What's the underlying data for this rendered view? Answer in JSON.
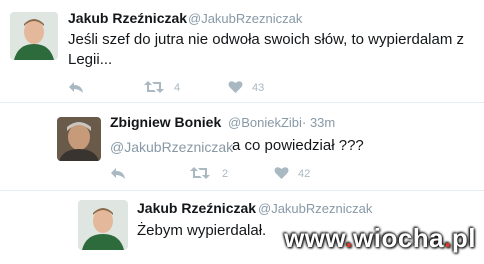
{
  "tweet1": {
    "name": "Jakub Rzeźniczak",
    "handle": "@JakubRzezniczak",
    "text_line1": "Jeśli szef do jutra nie odwoła swoich słów, to wypierdalam z",
    "text_line2": "Legii...",
    "retweets": "4",
    "likes": "43"
  },
  "tweet2": {
    "name": "Zbigniew Boniek",
    "handle": "@BoniekZibi",
    "time": "· 33m",
    "mention": "@JakubRzezniczak",
    "text": "a co powiedział ???",
    "retweets": "2",
    "likes": "42"
  },
  "tweet3": {
    "name": "Jakub Rzeźniczak",
    "handle": "@JakubRzezniczak",
    "text": "Żebym wypierdalał."
  },
  "watermark": {
    "part1": "www",
    "dot1": ".",
    "part2": "wiocha",
    "dot2": ".",
    "part3": "pl"
  },
  "icons": [
    "reply-icon",
    "retweet-icon",
    "like-icon"
  ],
  "colors": {
    "icon": "#aab8c2",
    "handle": "#8899a6",
    "watermark_dot": "#d93b2a"
  }
}
